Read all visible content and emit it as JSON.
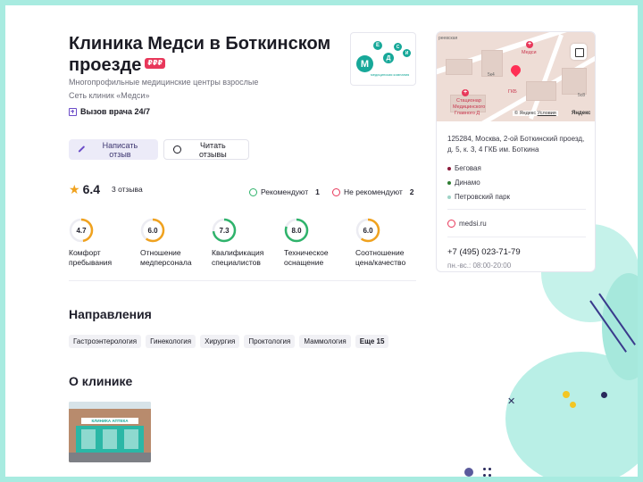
{
  "clinic": {
    "name": "Клиника Медси в Боткинском проезде",
    "rating_badge": "₽₽₽",
    "subtitle": "Многопрофильные медицинские центры взрослые",
    "network": "Сеть клиник «Медси»",
    "doctor_call": "Вызов врача 24/7"
  },
  "logo": {
    "letters": [
      "М",
      "Е",
      "Д",
      "С",
      "И"
    ],
    "tagline": "медицинская компания",
    "brand_color": "#17a899"
  },
  "actions": {
    "write_review": "Написать отзыв",
    "read_reviews": "Читать отзывы"
  },
  "rating": {
    "value": "6.4",
    "count": "3 отзыва",
    "recommend_label": "Рекомендуют",
    "recommend_count": "1",
    "not_recommend_label": "Не рекомендуют",
    "not_recommend_count": "2"
  },
  "scores": [
    {
      "value": "4.7",
      "line1": "Комфорт",
      "line2": "пребывания",
      "fraction": 0.47,
      "color": "#f0a21e"
    },
    {
      "value": "6.0",
      "line1": "Отношение",
      "line2": "медперсонала",
      "fraction": 0.6,
      "color": "#f0a21e"
    },
    {
      "value": "7.3",
      "line1": "Квалификация",
      "line2": "специалистов",
      "fraction": 0.73,
      "color": "#2fb36b"
    },
    {
      "value": "8.0",
      "line1": "Техническое",
      "line2": "оснащение",
      "fraction": 0.8,
      "color": "#2fb36b"
    },
    {
      "value": "6.0",
      "line1": "Соотношение",
      "line2": "цена/качество",
      "fraction": 0.6,
      "color": "#f0a21e"
    }
  ],
  "directions": {
    "title": "Направления",
    "items": [
      "Гастроэнтерология",
      "Гинекология",
      "Хирургия",
      "Проктология",
      "Маммология"
    ],
    "more": "Еще 15"
  },
  "about": {
    "title": "О клинике"
  },
  "photo": {
    "sign": "КЛИНИКА  АПТЕКА"
  },
  "map": {
    "street": "реевская",
    "poi_medsi": "Медси",
    "poi_gkb": "ГКБ",
    "poi_stationar": "Стационар",
    "poi_center": "Медицинского",
    "poi_main": "Главного Д",
    "bld1": "5к4",
    "bld2": "5с8",
    "copyright": "© Яндекс",
    "terms": "Условия",
    "brand": "Яндекс"
  },
  "contacts": {
    "address": "125284, Москва, 2-ой Боткинский проезд, д. 5, к. 3, 4 ГКБ им. Боткина",
    "metro": [
      {
        "name": "Беговая",
        "color": "#8b1a3a"
      },
      {
        "name": "Динамо",
        "color": "#2e7d32"
      },
      {
        "name": "Петровский парк",
        "color": "#9fd3c7"
      }
    ],
    "site": "medsi.ru",
    "phone": "+7 (495) 023-71-79",
    "hours": "пн.-вс.: 08:00-20:00"
  }
}
